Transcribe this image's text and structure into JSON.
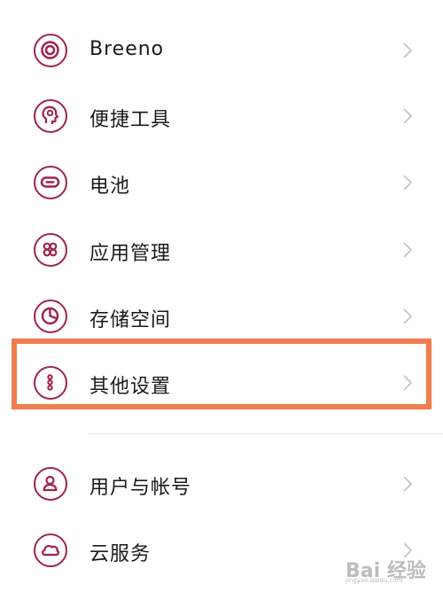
{
  "accent_color": "#a0244a",
  "highlight_color": "#ef7d4e",
  "settings": {
    "items": [
      {
        "label": "Breeno",
        "icon": "breeno-icon"
      },
      {
        "label": "便捷工具",
        "icon": "convenient-tools-icon"
      },
      {
        "label": "电池",
        "icon": "battery-icon"
      },
      {
        "label": "应用管理",
        "icon": "app-management-icon"
      },
      {
        "label": "存储空间",
        "icon": "storage-icon"
      },
      {
        "label": "其他设置",
        "icon": "more-settings-icon",
        "highlighted": true
      },
      {
        "label": "用户与帐号",
        "icon": "user-account-icon"
      },
      {
        "label": "云服务",
        "icon": "cloud-icon"
      }
    ]
  },
  "watermark": {
    "text": "Bai 经验",
    "sub": "jingyan.baidu.com"
  }
}
